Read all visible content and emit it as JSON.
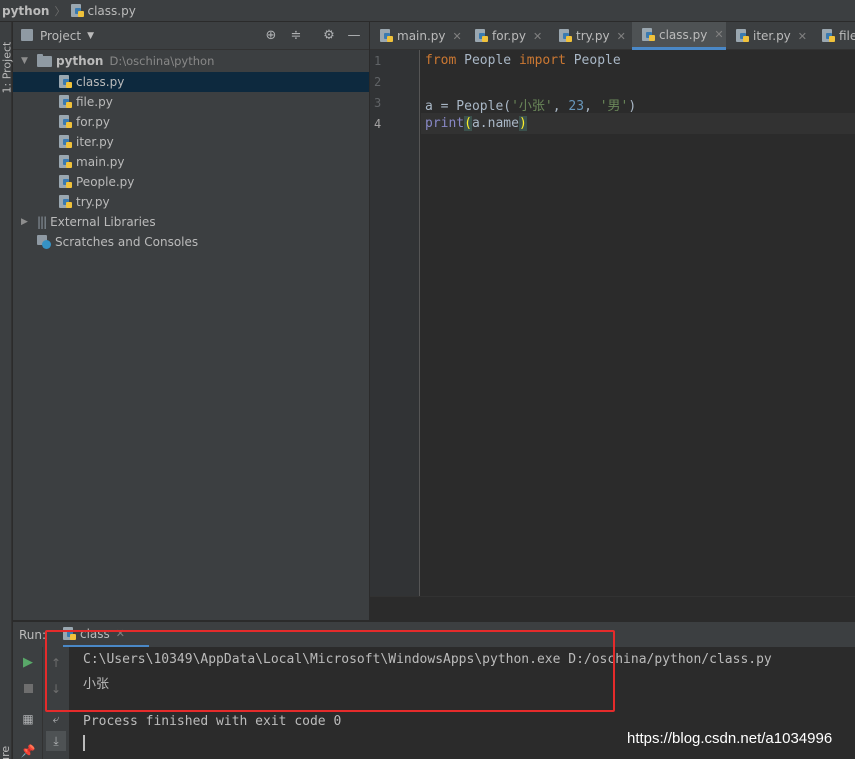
{
  "navbar": {
    "root": "python",
    "file": "class.py"
  },
  "left_strip": {
    "project_label": "1: Project",
    "structure_label": "ucture"
  },
  "project": {
    "title": "Project",
    "tree": {
      "root_name": "python",
      "root_path": "D:\\oschina\\python",
      "files": [
        "class.py",
        "file.py",
        "for.py",
        "iter.py",
        "main.py",
        "People.py",
        "try.py"
      ],
      "selected": "class.py",
      "external_libraries": "External Libraries",
      "scratches": "Scratches and Consoles"
    }
  },
  "editor": {
    "tabs": [
      "main.py",
      "for.py",
      "try.py",
      "class.py",
      "iter.py",
      "file"
    ],
    "active_tab": "class.py",
    "line_numbers": [
      "1",
      "2",
      "3",
      "4"
    ],
    "code": {
      "l1_kw1": "from",
      "l1_mod": " People ",
      "l1_kw2": "import",
      "l1_name": " People",
      "l3_a": "a = People(",
      "l3_s1": "'小张'",
      "l3_c1": ", ",
      "l3_n": "23",
      "l3_c2": ", ",
      "l3_s2": "'男'",
      "l3_end": ")",
      "l4_fn": "print",
      "l4_open": "(",
      "l4_arg": "a.name",
      "l4_close": ")"
    }
  },
  "run": {
    "title": "Run:",
    "tab_label": "class",
    "console": [
      "C:\\Users\\10349\\AppData\\Local\\Microsoft\\WindowsApps\\python.exe D:/oschina/python/class.py",
      "小张",
      "",
      "Process finished with exit code 0"
    ]
  },
  "watermark": "https://blog.csdn.net/a1034996",
  "colors": {
    "highlight_box": "#e52b2b",
    "accent": "#4a88c7",
    "selection": "#0d293e"
  }
}
